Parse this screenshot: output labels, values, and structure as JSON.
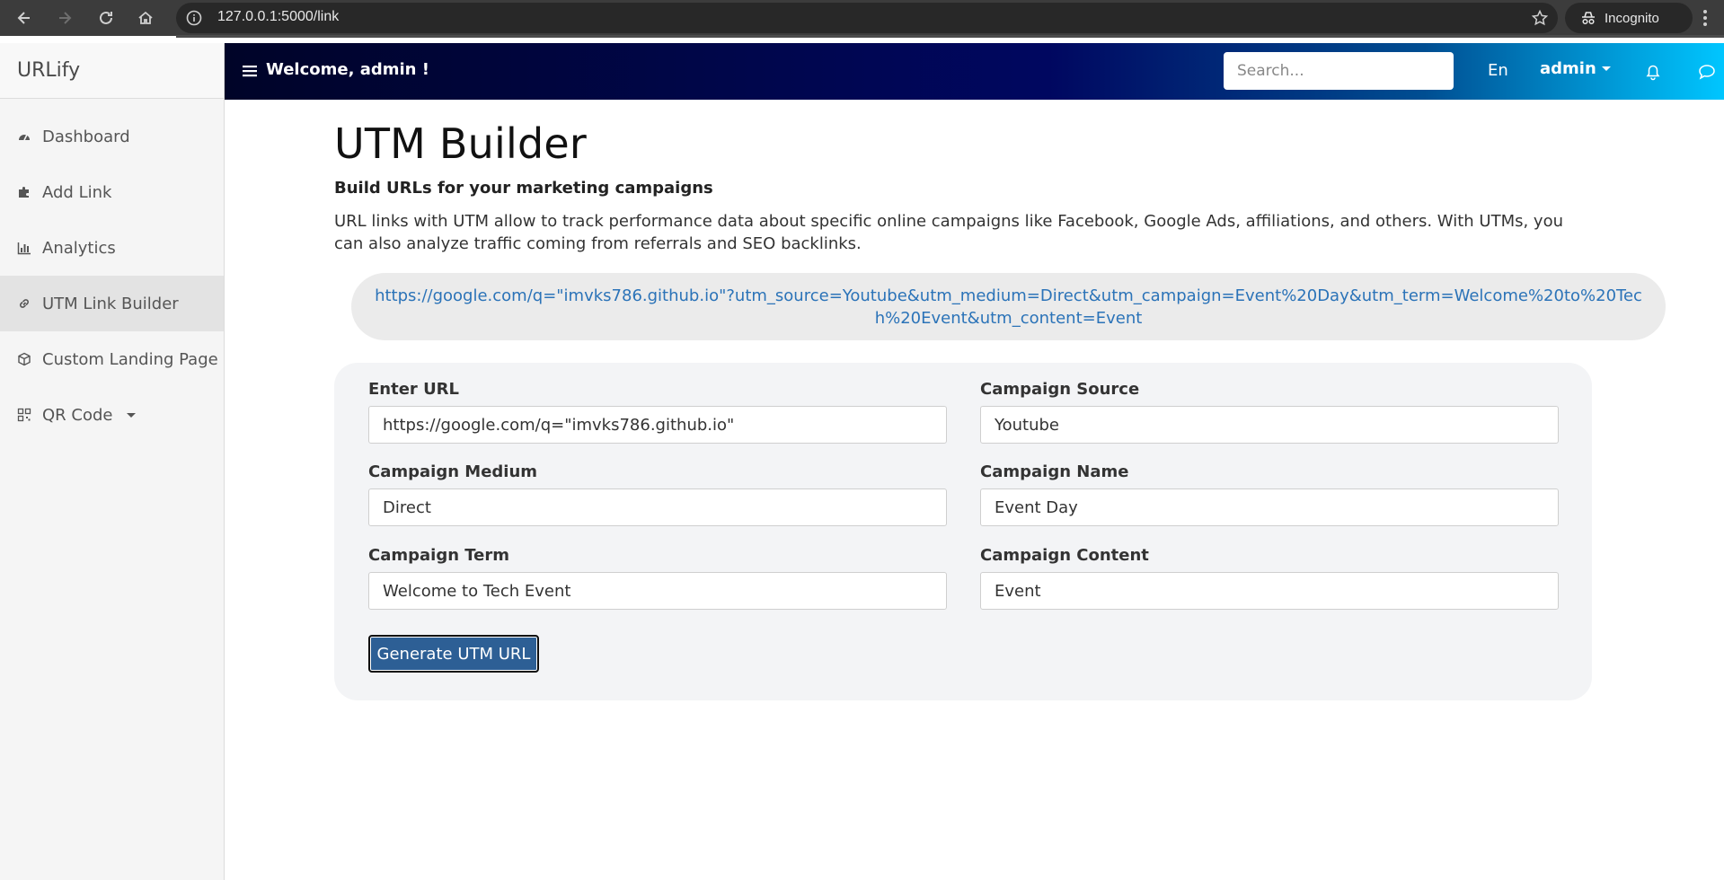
{
  "browser": {
    "url": "127.0.0.1:5000/link",
    "profile_label": "Incognito"
  },
  "app": {
    "brand": "URLify",
    "welcome": "Welcome, admin !",
    "search_placeholder": "Search...",
    "language": "En",
    "user": "admin"
  },
  "sidebar": {
    "items": [
      {
        "label": "Dashboard",
        "icon": "dashboard-icon"
      },
      {
        "label": "Add Link",
        "icon": "puzzle-icon"
      },
      {
        "label": "Analytics",
        "icon": "bar-chart-icon"
      },
      {
        "label": "UTM Link Builder",
        "icon": "link-icon",
        "active": true
      },
      {
        "label": "Custom Landing Page",
        "icon": "cube-icon"
      },
      {
        "label": "QR Code",
        "icon": "qr-code-icon",
        "dropdown": true
      }
    ]
  },
  "page": {
    "title": "UTM Builder",
    "subtitle": "Build URLs for your marketing campaigns",
    "description": "URL links with UTM allow to track performance data about specific online campaigns like Facebook, Google Ads, affiliations, and others. With UTMs, you can also analyze traffic coming from referrals and SEO backlinks.",
    "generated_url": "https://google.com/q=\"imvks786.github.io\"?utm_source=Youtube&utm_medium=Direct&utm_campaign=Event%20Day&utm_term=Welcome%20to%20Tech%20Event&utm_content=Event"
  },
  "form": {
    "url": {
      "label": "Enter URL",
      "value": "https://google.com/q=\"imvks786.github.io\""
    },
    "source": {
      "label": "Campaign Source",
      "value": "Youtube"
    },
    "medium": {
      "label": "Campaign Medium",
      "value": "Direct"
    },
    "name": {
      "label": "Campaign Name",
      "value": "Event Day"
    },
    "term": {
      "label": "Campaign Term",
      "value": "Welcome to Tech Event"
    },
    "content": {
      "label": "Campaign Content",
      "value": "Event"
    },
    "submit_label": "Generate UTM URL"
  },
  "colors": {
    "link": "#2b73b8",
    "button": "#2d5f95",
    "topbar_start": "#000428",
    "topbar_end": "#00c6ff"
  }
}
